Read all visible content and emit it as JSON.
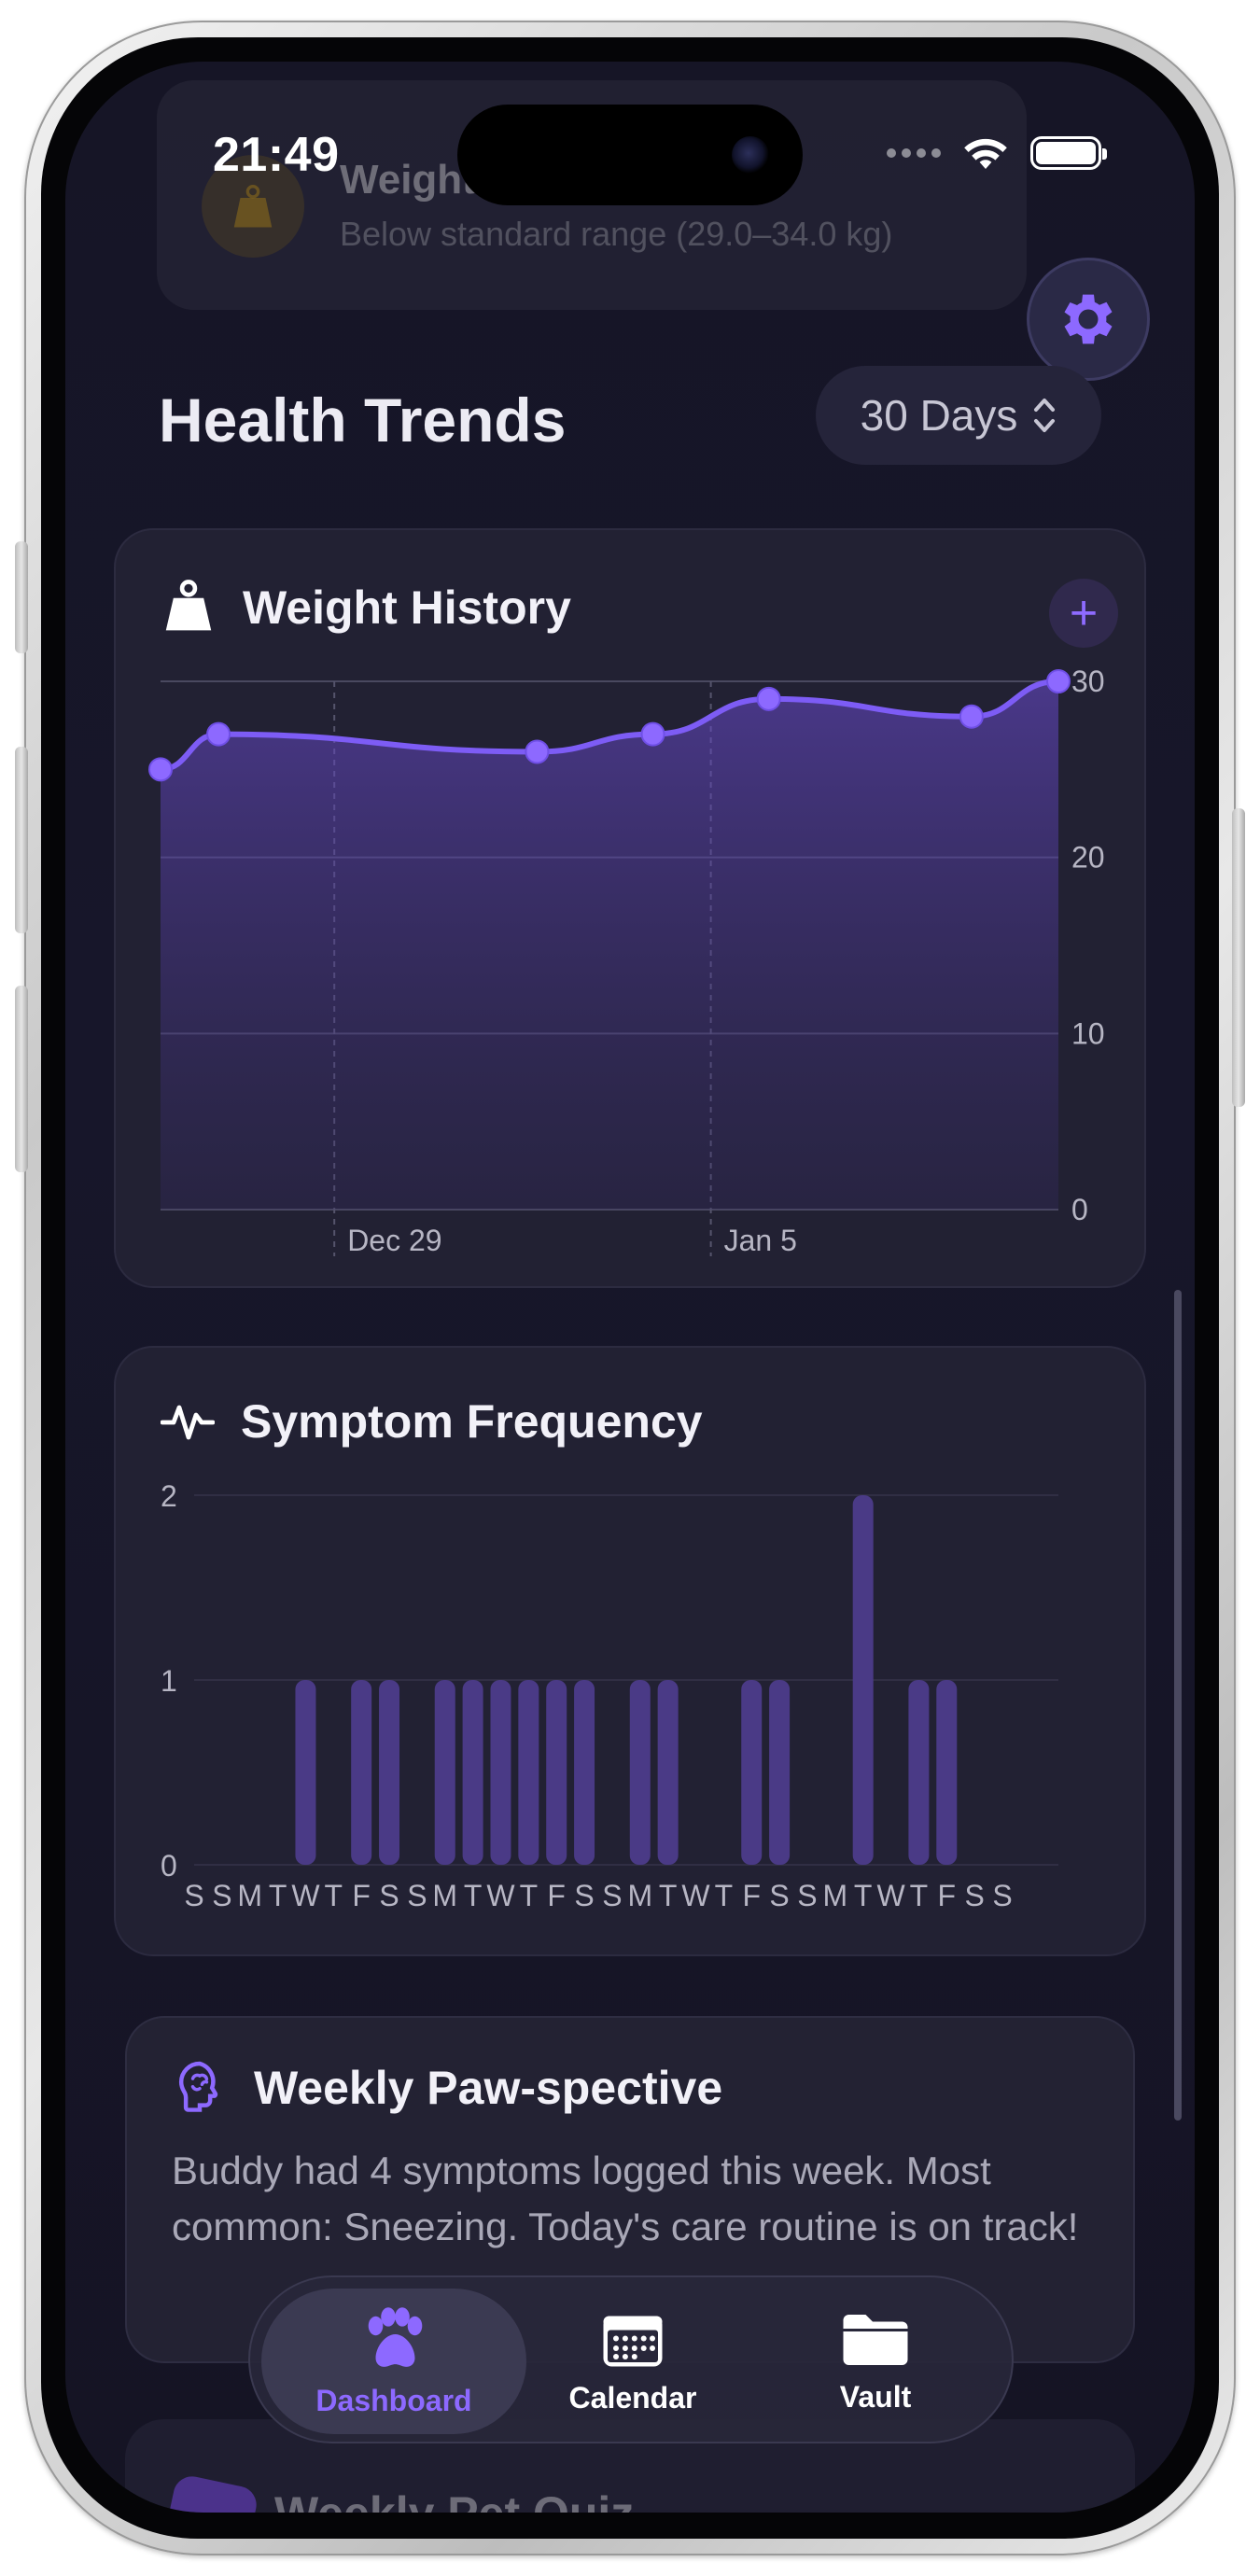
{
  "status": {
    "time": "21:49"
  },
  "alert": {
    "title": "Weight",
    "subtitle": "Below standard range (29.0–34.0 kg)"
  },
  "header": {
    "title": "Health Trends",
    "range_label": "30 Days"
  },
  "weight_card": {
    "title": "Weight History",
    "add_label": "+"
  },
  "symptom_card": {
    "title": "Symptom Frequency"
  },
  "insight": {
    "title": "Weekly Paw-spective",
    "body": "Buddy had 4 symptoms logged this week. Most common: Sneezing. Today's care routine is on track!"
  },
  "quiz": {
    "title": "Weekly Pet Quiz"
  },
  "tabs": [
    {
      "label": "Dashboard",
      "icon": "paw-icon",
      "active": true
    },
    {
      "label": "Calendar",
      "icon": "calendar-icon",
      "active": false
    },
    {
      "label": "Vault",
      "icon": "folder-icon",
      "active": false
    }
  ],
  "colors": {
    "accent": "#8d69ff",
    "background": "#161526",
    "card": "#222133"
  },
  "chart_data": [
    {
      "type": "area",
      "title": "Weight History",
      "x_ticks": [
        "Dec 29",
        "Jan 5"
      ],
      "y_ticks": [
        0,
        10,
        20,
        30
      ],
      "ylim": [
        0,
        30
      ],
      "x_index_range": [
        0,
        30
      ],
      "x_tick_index": [
        6,
        19
      ],
      "series": [
        {
          "x": [
            0,
            2,
            13,
            17,
            21,
            28,
            31
          ],
          "values": [
            25,
            27,
            26,
            27,
            29,
            28,
            30
          ]
        }
      ],
      "grid": true
    },
    {
      "type": "bar",
      "title": "Symptom Frequency",
      "categories": [
        "S",
        "S",
        "M",
        "T",
        "W",
        "T",
        "F",
        "S",
        "S",
        "M",
        "T",
        "W",
        "T",
        "F",
        "S",
        "S",
        "M",
        "T",
        "W",
        "T",
        "F",
        "S",
        "S",
        "M",
        "T",
        "W",
        "T",
        "F",
        "S",
        "S"
      ],
      "values": [
        0,
        0,
        0,
        0,
        1,
        0,
        1,
        1,
        0,
        1,
        1,
        1,
        1,
        1,
        1,
        0,
        1,
        1,
        0,
        0,
        1,
        1,
        0,
        0,
        2,
        0,
        1,
        1,
        0,
        0
      ],
      "y_ticks": [
        0,
        1,
        2
      ],
      "ylim": [
        0,
        2
      ],
      "grid": true
    }
  ]
}
